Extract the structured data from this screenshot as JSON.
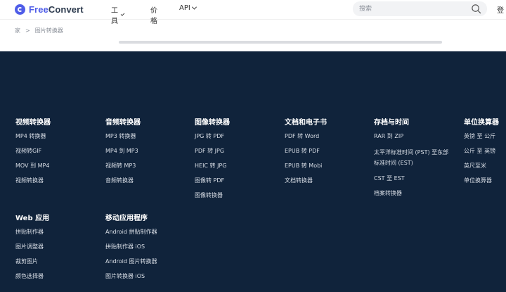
{
  "header": {
    "logo_free": "Free",
    "logo_convert": "Convert",
    "nav": {
      "tools": "工具",
      "price": "价格",
      "api": "API"
    },
    "search_placeholder": "搜索",
    "login": "登"
  },
  "breadcrumb": {
    "home": "家",
    "separator": ">",
    "current": "图片转换器"
  },
  "footer": {
    "columns": [
      {
        "title": "视频转换器",
        "links": [
          "MP4 转换器",
          "视频转GIF",
          "MOV 到 MP4",
          "视频转换器"
        ]
      },
      {
        "title": "音频转换器",
        "links": [
          "MP3 转换器",
          "MP4 到 MP3",
          "视频转 MP3",
          "音频转换器"
        ]
      },
      {
        "title": "图像转换器",
        "links": [
          "JPG 转 PDF",
          "PDF 转 JPG",
          "HEIC 转 JPG",
          "图像转 PDF",
          "图像转换器"
        ]
      },
      {
        "title": "文档和电子书",
        "links": [
          "PDF 转 Word",
          "EPUB 转 PDF",
          "EPUB 转 Mobi",
          "文档转换器"
        ]
      },
      {
        "title": "存档与时间",
        "links": [
          "RAR 到 ZIP",
          "太平洋标准时间 (PST) 至东部标准时间 (EST)",
          "CST 至 EST",
          "档案转换器"
        ]
      },
      {
        "title": "单位换算器",
        "links": [
          "英镑 至 公斤",
          "公斤 至 英镑",
          "英尺至米",
          "单位换算器"
        ]
      },
      {
        "title": "Web 应用",
        "links": [
          "拼贴制作器",
          "图片调整器",
          "裁剪图片",
          "颜色选择器"
        ]
      },
      {
        "title": "移动应用程序",
        "links": [
          "Android 拼贴制作器",
          "拼贴制作器 iOS",
          "Android 图片转换器",
          "图片转换器 iOS"
        ]
      }
    ]
  },
  "colors": {
    "brand": "#4f5de8",
    "footer_bg": "#10233b"
  }
}
